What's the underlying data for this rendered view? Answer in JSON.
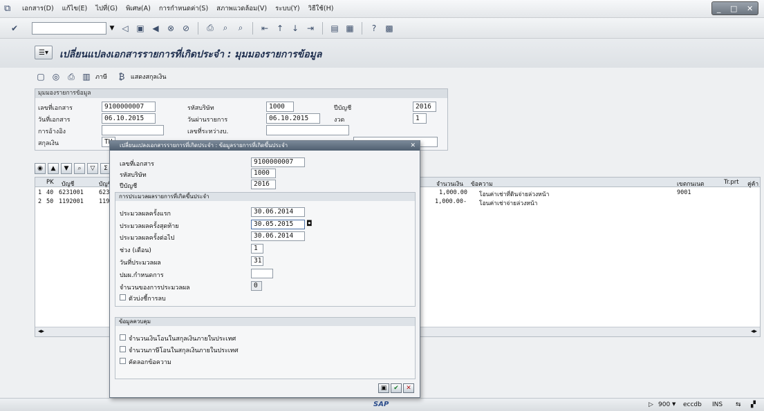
{
  "menubar": {
    "items": [
      "เอกสาร(D)",
      "แก้ไข(E)",
      "ไปที่(G)",
      "พิเศษ(A)",
      "การกำหนดค่า(S)",
      "สภาพแวดล้อม(V)",
      "ระบบ(Y)",
      "วิธีใช้(H)"
    ]
  },
  "screen": {
    "title": "เปลี่ยนแปลงเอกสารรายการที่เกิดประจำ : มุมมองรายการข้อมูล"
  },
  "app_toolbar": {
    "tax_label": "ภาษี",
    "currency_label": "แสดงสกุลเงิน"
  },
  "header": {
    "group_title": "มุมมองรายการข้อมูล",
    "doc_no_label": "เลขที่เอกสาร",
    "doc_no": "9100000007",
    "company_label": "รหัสบริษัท",
    "company": "1000",
    "fy_label": "ปีบัญชี",
    "fy": "2016",
    "doc_date_label": "วันที่เอกสาร",
    "doc_date": "06.10.2015",
    "post_date_label": "วันผ่านรายการ",
    "post_date": "06.10.2015",
    "period_label": "งวด",
    "period": "1",
    "ref_label": "การอ้างอิง",
    "cross_label": "เลขที่ระหว่างบ.",
    "currency_label": "สกุลเงิน",
    "currency_value": "TH"
  },
  "grid": {
    "columns": [
      "PK",
      "บัญชี",
      "บัญชี G",
      "จำนวนเงิน",
      "ข้อความ",
      "เขตกนเนต",
      "Tr.prt",
      "คู่ค้า"
    ],
    "rows": [
      {
        "no": "1",
        "pk": "40",
        "account": "6231001",
        "gl": "62310",
        "amount": "1,000.00",
        "text": "โอนค่าเช่าที่ดินจ่ายล่วงหน้า",
        "cost": "9001"
      },
      {
        "no": "2",
        "pk": "50",
        "account": "1192001",
        "gl": "11920",
        "amount": "1,000.00-",
        "text": "โอนค่าเช่าจ่ายล่วงหน้า",
        "cost": ""
      }
    ]
  },
  "dialog": {
    "title": "เปลี่ยนแปลงเอกสารรายการที่เกิดประจำ : ข้อมูลรายการที่เกิดขึ้นประจำ",
    "doc_no_label": "เลขที่เอกสาร",
    "doc_no": "9100000007",
    "company_label": "รหัสบริษัท",
    "company": "1000",
    "fy_label": "ปีบัญชี",
    "fy": "2016",
    "run_group": "การประมวลผลรายการที่เกิดขึ้นประจำ",
    "first_run_label": "ประมวลผลครั้งแรก",
    "first_run": "30.06.2014",
    "last_run_label": "ประมวลผลครั้งสุดท้าย",
    "last_run": "30.05.2015",
    "next_run_label": "ประมวลผลครั้งต่อไป",
    "next_run": "30.06.2014",
    "interval_label": "ช่วง (เดือน)",
    "interval": "1",
    "run_day_label": "วันที่ประมวลผล",
    "run_day": "31",
    "calendar_label": "ปมผ.กำหนดการ",
    "count_label": "จำนวนของการประมวลผล",
    "count": "0",
    "delete_flag_label": "ตัวบ่งชี้การลบ",
    "transfer_group": "ข้อมูลควบคุม",
    "opt1": "จำนวนเงินโอนในสกุลเงินภายในประเทศ",
    "opt2": "จำนวนภาษีโอนในสกุลเงินภายในประเทศ",
    "opt3": "คัดลอกข้อความ"
  },
  "status": {
    "client": "900",
    "host": "eccdb",
    "mode": "INS"
  },
  "sap_logo": "SAP"
}
